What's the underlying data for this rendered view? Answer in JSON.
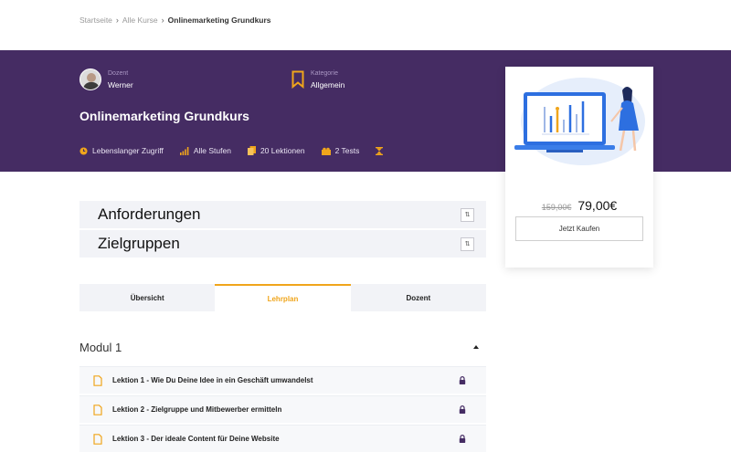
{
  "breadcrumb": {
    "items": [
      "Startseite",
      "Alle Kurse",
      "Onlinemarketing Grundkurs"
    ],
    "separator": "›"
  },
  "instructor": {
    "label": "Dozent",
    "name": "Werner"
  },
  "category": {
    "label": "Kategorie",
    "value": "Allgemein"
  },
  "course": {
    "title": "Onlinemarketing Grundkurs"
  },
  "stats": [
    {
      "icon": "clock-icon",
      "label": "Lebenslanger Zugriff"
    },
    {
      "icon": "signal-bars-icon",
      "label": "Alle Stufen"
    },
    {
      "icon": "files-icon",
      "label": "20 Lektionen"
    },
    {
      "icon": "puzzle-icon",
      "label": "2 Tests"
    },
    {
      "icon": "hourglass-icon",
      "label": ""
    }
  ],
  "card": {
    "old_price": "159,00€",
    "price": "79,00€",
    "buy_label": "Jetzt Kaufen"
  },
  "accordions": [
    {
      "title": "Anforderungen",
      "toggle": "⇅"
    },
    {
      "title": "Zielgruppen",
      "toggle": "⇅"
    }
  ],
  "tabs": [
    {
      "label": "Übersicht",
      "active": false
    },
    {
      "label": "Lehrplan",
      "active": true
    },
    {
      "label": "Dozent",
      "active": false
    }
  ],
  "module": {
    "title": "Modul 1"
  },
  "lessons": [
    {
      "title": "Lektion 1 - Wie Du Deine Idee in ein Geschäft umwandelst",
      "locked": true
    },
    {
      "title": "Lektion 2 - Zielgruppe und Mitbewerber ermitteln",
      "locked": true
    },
    {
      "title": "Lektion 3 - Der ideale Content für Deine Website",
      "locked": true
    }
  ],
  "colors": {
    "hero_bg": "#452c63",
    "accent": "#f0a51b",
    "lock": "#452c63"
  }
}
